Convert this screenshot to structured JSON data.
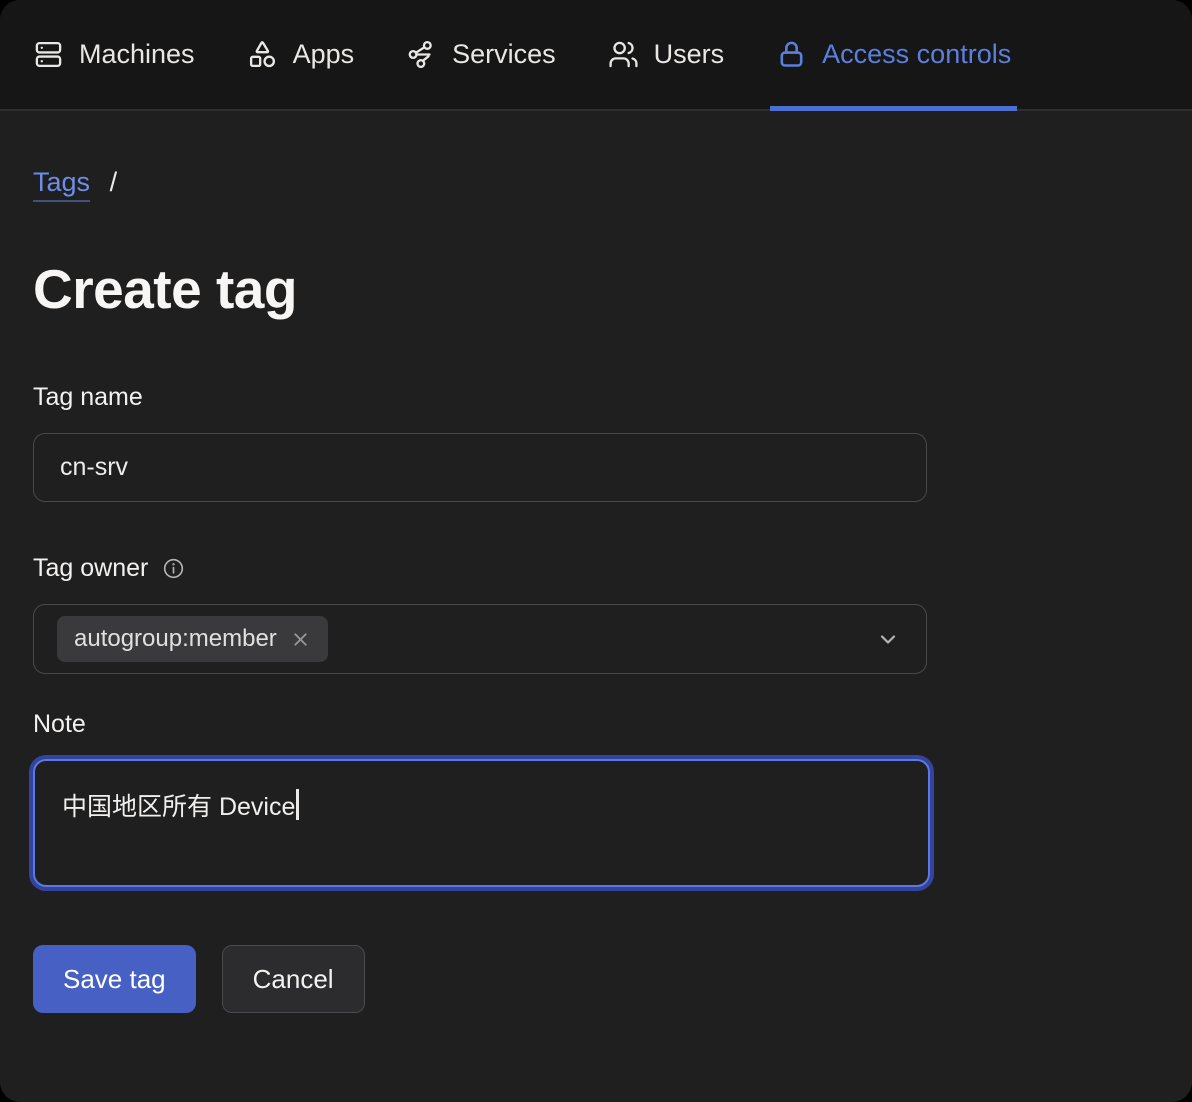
{
  "nav": {
    "items": [
      {
        "label": "Machines",
        "icon": "server-icon",
        "active": false
      },
      {
        "label": "Apps",
        "icon": "shapes-icon",
        "active": false
      },
      {
        "label": "Services",
        "icon": "nodes-icon",
        "active": false
      },
      {
        "label": "Users",
        "icon": "users-icon",
        "active": false
      },
      {
        "label": "Access controls",
        "icon": "lock-icon",
        "active": true
      }
    ]
  },
  "breadcrumb": {
    "link": "Tags",
    "separator": "/"
  },
  "page": {
    "title": "Create tag"
  },
  "form": {
    "tag_name": {
      "label": "Tag name",
      "value": "cn-srv"
    },
    "tag_owner": {
      "label": "Tag owner",
      "info_icon": "info-icon",
      "selected": [
        {
          "value": "autogroup:member",
          "remove_icon": "close-icon"
        }
      ],
      "dropdown_icon": "chevron-down-icon"
    },
    "note": {
      "label": "Note",
      "value": "中国地区所有 Device"
    }
  },
  "actions": {
    "save": "Save tag",
    "cancel": "Cancel"
  },
  "colors": {
    "accent_blue": "#5c7fdd",
    "tab_underline": "#4d6fd0",
    "primary_button": "#4760c4",
    "focus_ring": "#32449d",
    "link_blue": "#6d8ee8",
    "nav_background": "#161617",
    "page_background": "#1f1f20"
  }
}
